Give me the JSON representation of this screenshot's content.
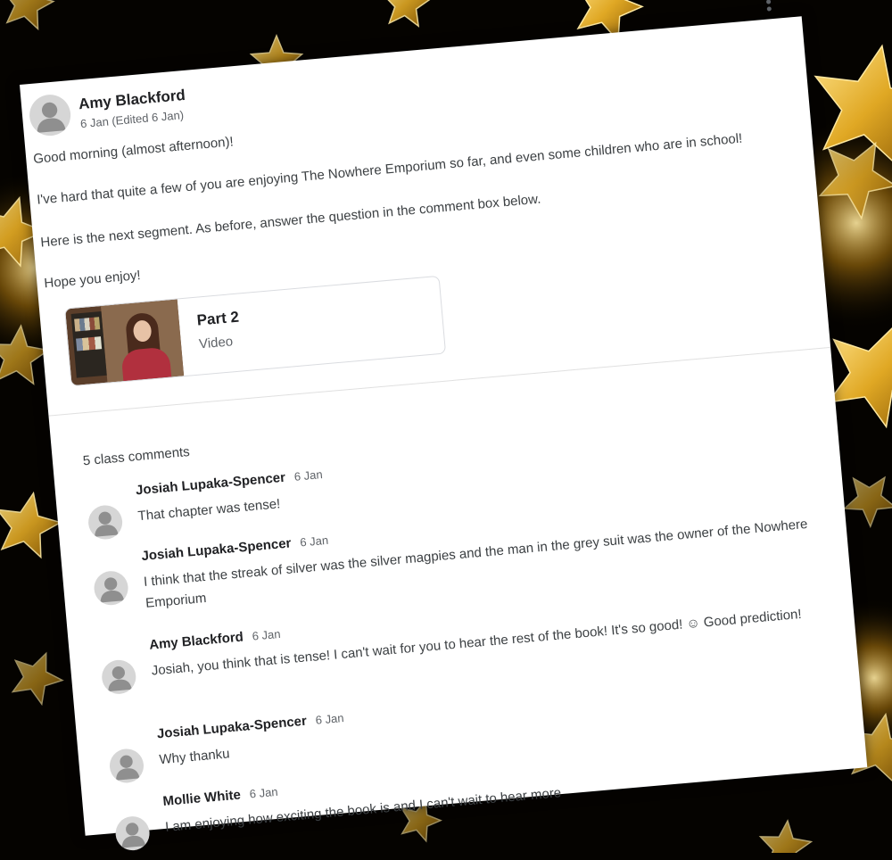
{
  "post": {
    "author": "Amy Blackford",
    "date": "6 Jan (Edited 6 Jan)",
    "lines": [
      "Good morning (almost afternoon)!",
      "I've hard that quite a few of you are enjoying The Nowhere Emporium so far, and even some children who are in school!",
      "Here is the next segment. As before, answer the question in the comment box below.",
      "Hope you enjoy!"
    ],
    "menu_icon": "more-vert-icon"
  },
  "attachment": {
    "title": "Part 2",
    "type": "Video"
  },
  "comments_header": "5 class comments",
  "comments": [
    {
      "name": "Josiah Lupaka-Spencer",
      "date": "6 Jan",
      "text": "That chapter was tense!"
    },
    {
      "name": "Josiah Lupaka-Spencer",
      "date": "6 Jan",
      "text": "I think that the streak of silver was the silver magpies and the man in the grey suit was the owner of the Nowhere Emporium"
    },
    {
      "name": "Amy Blackford",
      "date": "6 Jan",
      "text": "Josiah, you think that is tense! I can't wait for you to hear the rest of the book! It's so good! ☺ Good prediction!"
    },
    {
      "name": "Josiah Lupaka-Spencer",
      "date": "6 Jan",
      "text": "Why thanku"
    },
    {
      "name": "Mollie White",
      "date": "6 Jan",
      "text": "I am enjoying how exciting the book is and I can't wait to hear more"
    }
  ],
  "colors": {
    "background": "#050300",
    "star_gold": "#d9a820",
    "card": "#ffffff"
  }
}
